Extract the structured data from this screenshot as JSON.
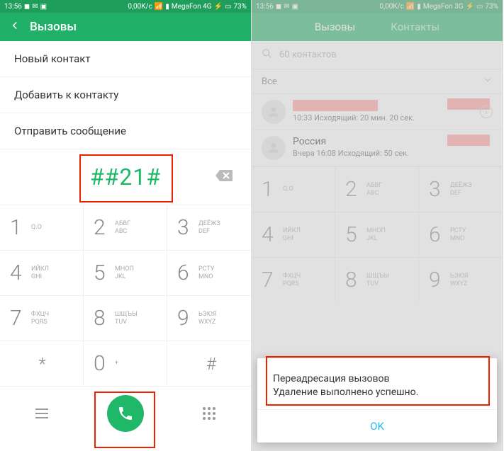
{
  "left": {
    "status": {
      "time": "13:56",
      "net": "0,00K/c",
      "carrier": "MegaFon 4G",
      "battery": "73%"
    },
    "header": {
      "title": "Вызовы"
    },
    "menu": [
      "Новый контакт",
      "Добавить к контакту",
      "Отправить сообщение"
    ],
    "dialed": "##21#",
    "keypad": [
      {
        "d": "1",
        "t": "",
        "b": "Q.O"
      },
      {
        "d": "2",
        "t": "АБВГ",
        "b": "ABC"
      },
      {
        "d": "3",
        "t": "ДЕЁЖЗ",
        "b": "DEF"
      },
      {
        "d": "4",
        "t": "ИЙКЛ",
        "b": "GHI"
      },
      {
        "d": "5",
        "t": "МНОП",
        "b": "JKL"
      },
      {
        "d": "6",
        "t": "РСТУ",
        "b": "MNO"
      },
      {
        "d": "7",
        "t": "ФХЦЧ",
        "b": "PQRS"
      },
      {
        "d": "8",
        "t": "ШЩЪЫ",
        "b": "TUV"
      },
      {
        "d": "9",
        "t": "ЬЭЮЯ",
        "b": "WXYZ"
      },
      {
        "d": "*",
        "t": "",
        "b": ""
      },
      {
        "d": "0",
        "t": "+",
        "b": ""
      },
      {
        "d": "#",
        "t": "",
        "b": ""
      }
    ]
  },
  "right": {
    "status": {
      "time": "13:56",
      "net": "0,00K/c",
      "carrier": "MegaFon 3G",
      "battery": "73%"
    },
    "tabs": {
      "calls": "Вызовы",
      "contacts": "Контакты"
    },
    "search": "60 контактов",
    "filter": "Все",
    "log": [
      {
        "line": "10:33 Исходящий: 20 мин. 20 сек."
      },
      {
        "name": "Россия",
        "line": "Вчера 16:08 Исходящий: 50 сек."
      }
    ],
    "dialog": {
      "line1": "Переадресация вызовов",
      "line2": "Удаление выполнено успешно.",
      "ok": "OK"
    }
  }
}
